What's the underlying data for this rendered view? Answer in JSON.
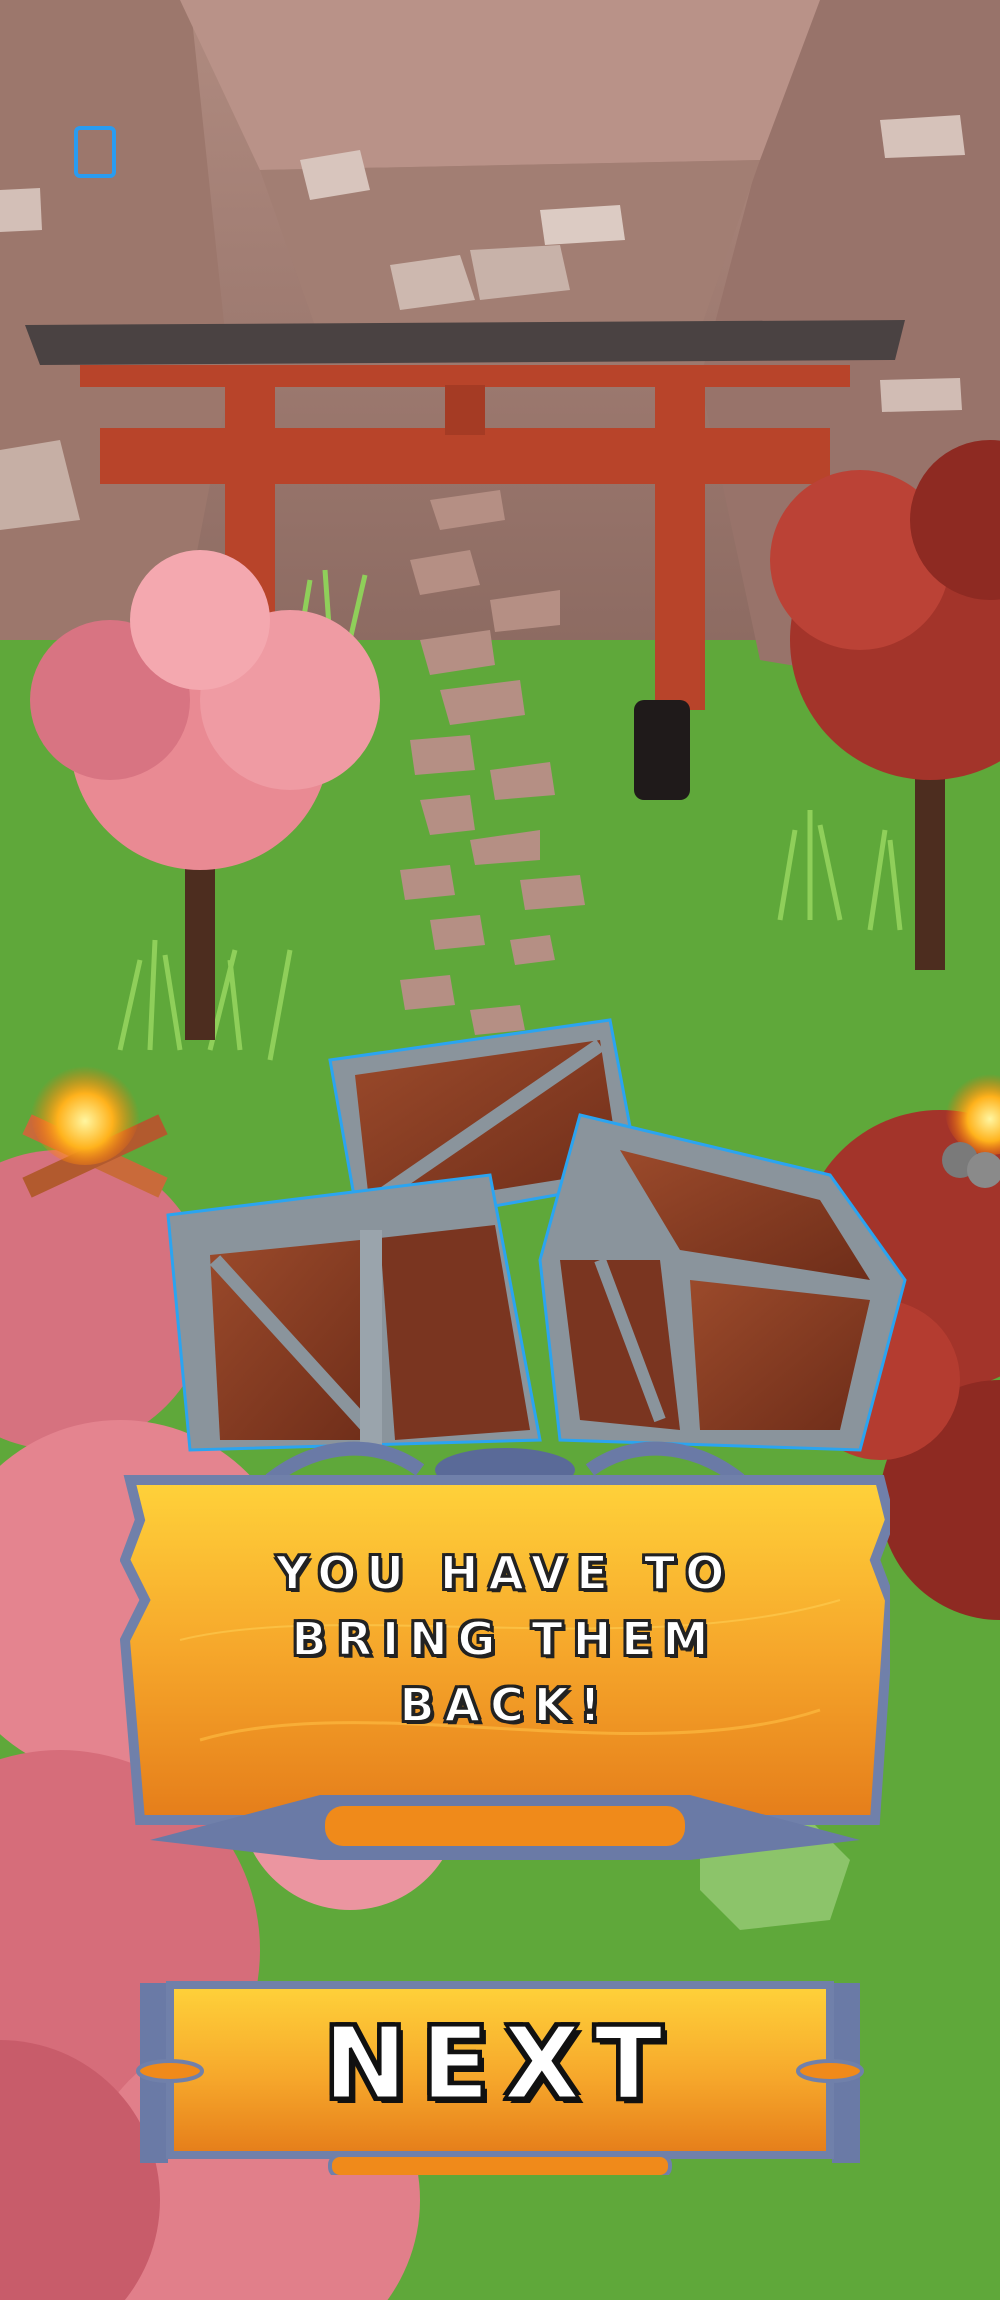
{
  "scene": {
    "name": "Shrine garden with torii gate",
    "colors": {
      "sky_rock": "#a57f74",
      "grass": "#5fa83a",
      "torii": "#b8442a",
      "blossom": "#e98a93",
      "crate_wood": "#8a3f26",
      "crate_metal": "#8a949c",
      "panel_orange": "#f2a526",
      "panel_frame": "#6a7aa6"
    }
  },
  "hud": {
    "icon": "square-outline-icon"
  },
  "dialog": {
    "line1": "YOU HAVE TO",
    "line2": "BRING THEM",
    "line3": "BACK!"
  },
  "next_button": {
    "label": "NEXT"
  }
}
